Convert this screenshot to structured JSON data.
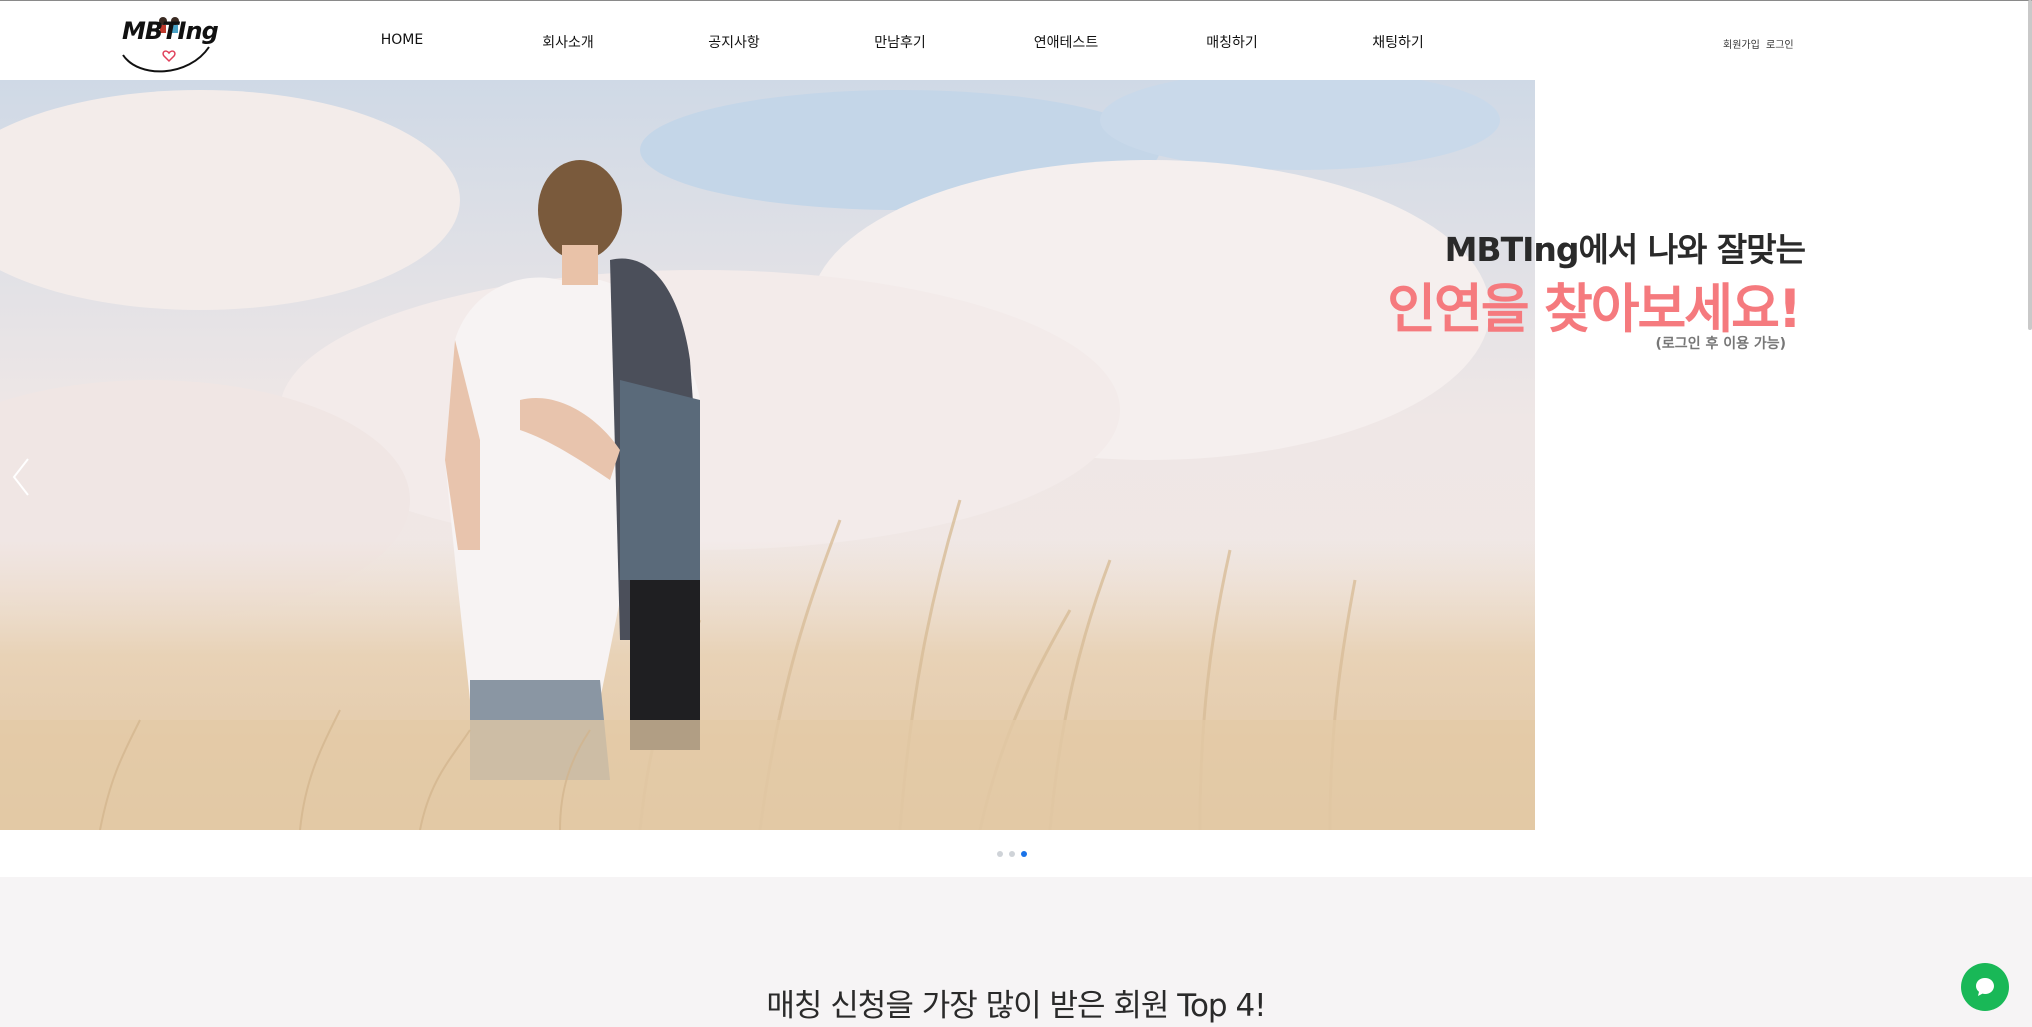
{
  "header": {
    "logo_text": "MBTIng",
    "nav": [
      {
        "label": "HOME"
      },
      {
        "label": "회사소개"
      },
      {
        "label": "공지사항"
      },
      {
        "label": "만남후기"
      },
      {
        "label": "연애테스트"
      },
      {
        "label": "매칭하기"
      },
      {
        "label": "채팅하기"
      }
    ],
    "signup_label": "회원가입",
    "login_label": "로그인"
  },
  "hero": {
    "line1": "MBTIng에서 나와 잘맞는",
    "line2": "인연을 찾아보세요!",
    "note": "(로그인 후 이용 가능)",
    "slide_count": 3,
    "active_slide": 3
  },
  "section": {
    "title": "매칭 신청을 가장 많이 받은 회원 Top 4!"
  },
  "colors": {
    "accent_pink": "#f57a7e",
    "dot_active": "#1a73e8",
    "chat_green": "#19b857"
  },
  "icons": {
    "prev": "chevron-left-icon",
    "chat": "chat-bubble-icon"
  }
}
